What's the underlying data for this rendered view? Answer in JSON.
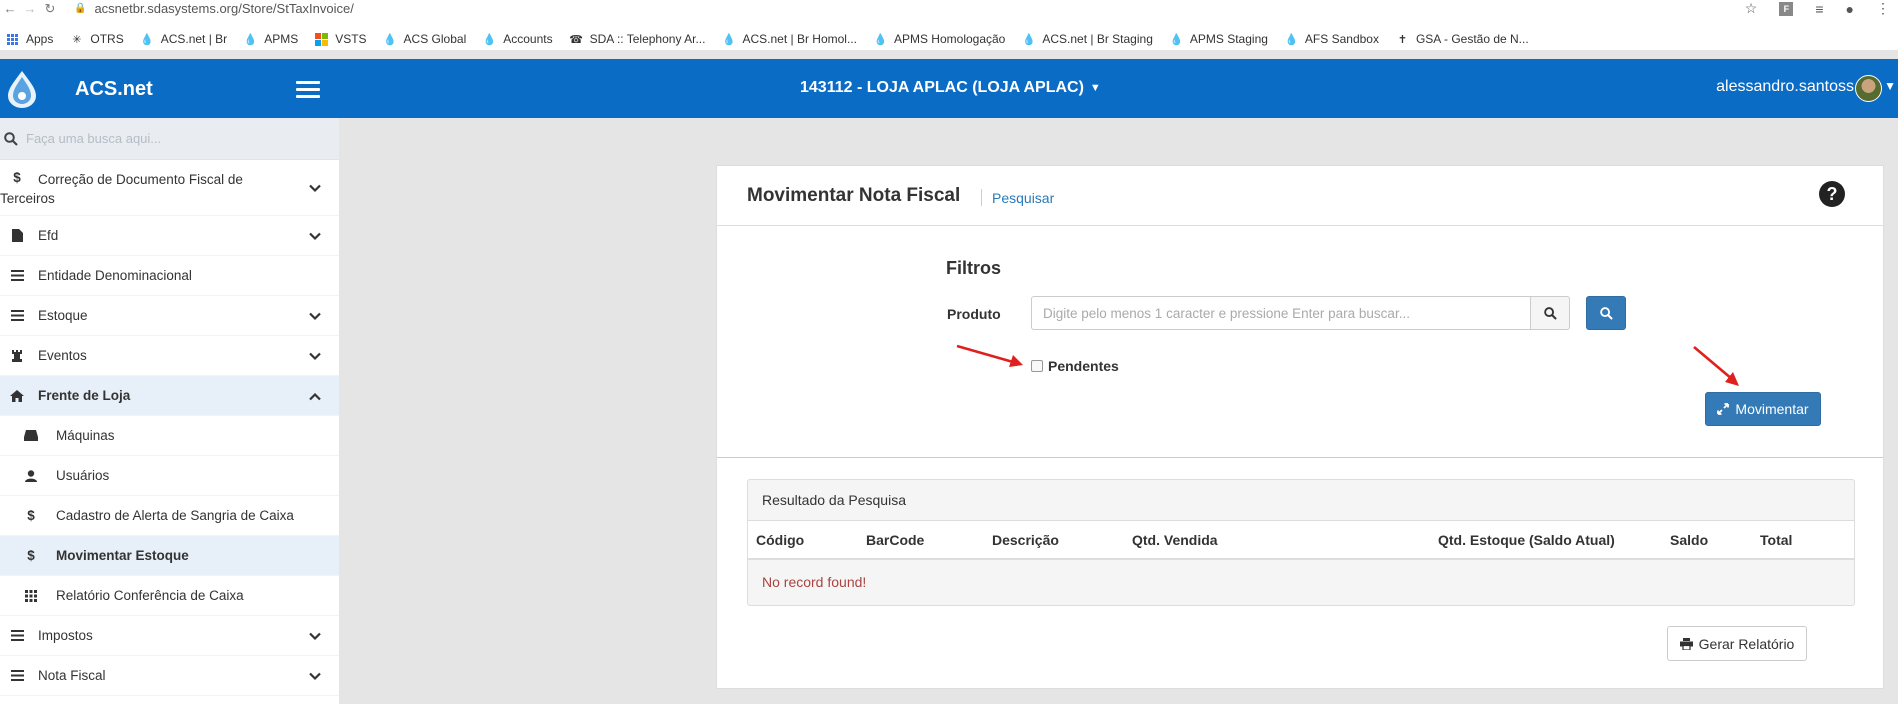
{
  "browser": {
    "url": "acsnetbr.sdasystems.org/Store/StTaxInvoice/",
    "bookmarks": [
      {
        "label": "Apps",
        "icon": "apps-grid-icon"
      },
      {
        "label": "OTRS",
        "icon": "star-burst-icon"
      },
      {
        "label": "ACS.net | Br",
        "icon": "acs-drop-icon"
      },
      {
        "label": "APMS",
        "icon": "acs-drop-icon"
      },
      {
        "label": "VSTS",
        "icon": "windows-logo-icon"
      },
      {
        "label": "ACS Global",
        "icon": "acs-drop-icon"
      },
      {
        "label": "Accounts",
        "icon": "acs-drop-icon"
      },
      {
        "label": "SDA :: Telephony Ar...",
        "icon": "phone-icon"
      },
      {
        "label": "ACS.net | Br Homol...",
        "icon": "acs-drop-icon"
      },
      {
        "label": "APMS Homologação",
        "icon": "acs-drop-icon"
      },
      {
        "label": "ACS.net | Br Staging",
        "icon": "acs-drop-icon"
      },
      {
        "label": "APMS Staging",
        "icon": "acs-drop-icon"
      },
      {
        "label": "AFS Sandbox",
        "icon": "acs-drop-icon"
      },
      {
        "label": "GSA - Gestão de N...",
        "icon": "pin-icon"
      }
    ]
  },
  "header": {
    "brand": "ACS.net",
    "store": "143112 - LOJA APLAC (LOJA APLAC)",
    "user": "alessandro.santoss",
    "accent": "#0a6cc5"
  },
  "sidebar": {
    "search_placeholder": "Faça uma busca aqui...",
    "items": [
      {
        "label": "Correção de Documento Fiscal de",
        "label2": "Terceiros",
        "icon": "dollar-icon"
      },
      {
        "label": "Efd",
        "icon": "file-icon"
      },
      {
        "label": "Entidade Denominacional",
        "icon": "list-icon"
      },
      {
        "label": "Estoque",
        "icon": "list-icon"
      },
      {
        "label": "Eventos",
        "icon": "chess-rook-icon"
      },
      {
        "label": "Frente de Loja",
        "icon": "home-icon"
      },
      {
        "label": "Máquinas",
        "icon": "hdd-icon"
      },
      {
        "label": "Usuários",
        "icon": "user-icon"
      },
      {
        "label": "Cadastro de Alerta de Sangria de Caixa",
        "icon": "dollar-icon"
      },
      {
        "label": "Movimentar Estoque",
        "icon": "dollar-icon"
      },
      {
        "label": "Relatório Conferência de Caixa",
        "icon": "grid-icon"
      },
      {
        "label": "Impostos",
        "icon": "list-icon"
      },
      {
        "label": "Nota Fiscal",
        "icon": "list-icon"
      }
    ]
  },
  "main": {
    "title": "Movimentar Nota Fiscal",
    "search_link": "Pesquisar",
    "help": "?",
    "filters_title": "Filtros",
    "product_label": "Produto",
    "product_placeholder": "Digite pelo menos 1 caracter e pressione Enter para buscar...",
    "pending_label": "Pendentes",
    "move_button": "Movimentar",
    "result_title": "Resultado da Pesquisa",
    "columns": [
      "Código",
      "BarCode",
      "Descrição",
      "Qtd. Vendida",
      "Qtd. Estoque (Saldo Atual)",
      "Saldo",
      "Total"
    ],
    "empty_message": "No record found!",
    "report_button": "Gerar Relatório"
  }
}
